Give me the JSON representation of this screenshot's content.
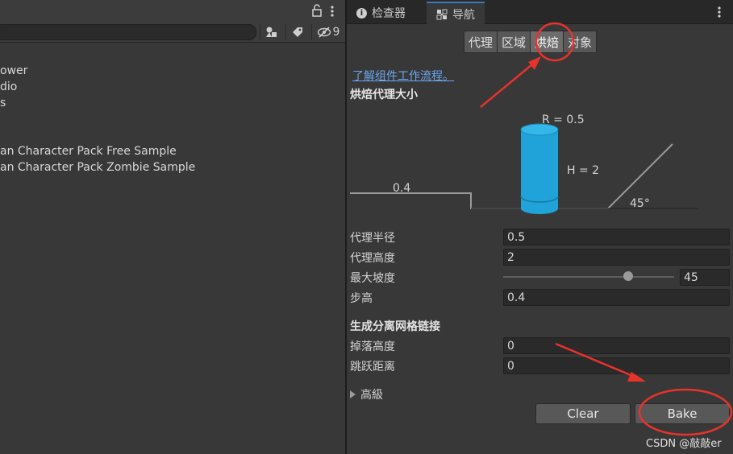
{
  "left": {
    "search_count": "9",
    "items": [
      "ower",
      "dio",
      "s",
      "an Character Pack Free Sample",
      "an Character Pack Zombie Sample"
    ]
  },
  "tabs": {
    "inspector": "检查器",
    "navigation": "导航"
  },
  "segments": [
    "代理",
    "区域",
    "烘焙",
    "对象"
  ],
  "active_segment": "烘焙",
  "link": "了解组件工作流程。",
  "agent_size_heading": "烘焙代理大小",
  "diagram": {
    "radius_label": "R = 0.5",
    "height_label": "H = 2",
    "step_label": "0.4",
    "slope_label": "45°"
  },
  "fields": {
    "agent_radius": {
      "label": "代理半径",
      "value": "0.5"
    },
    "agent_height": {
      "label": "代理高度",
      "value": "2"
    },
    "max_slope": {
      "label": "最大坡度",
      "value": "45",
      "fraction": 0.73
    },
    "step_height": {
      "label": "步高",
      "value": "0.4"
    }
  },
  "offmesh_heading": "生成分离网格链接",
  "offmesh": {
    "drop_height": {
      "label": "掉落高度",
      "value": "0"
    },
    "jump_distance": {
      "label": "跳跃距离",
      "value": "0"
    }
  },
  "advanced": "高級",
  "buttons": {
    "clear": "Clear",
    "bake": "Bake"
  },
  "watermark": "CSDN @敲敲er",
  "colors": {
    "accent": "#3a79bb",
    "cylinder": "#1fa3d8",
    "annotation": "#e8322c"
  }
}
